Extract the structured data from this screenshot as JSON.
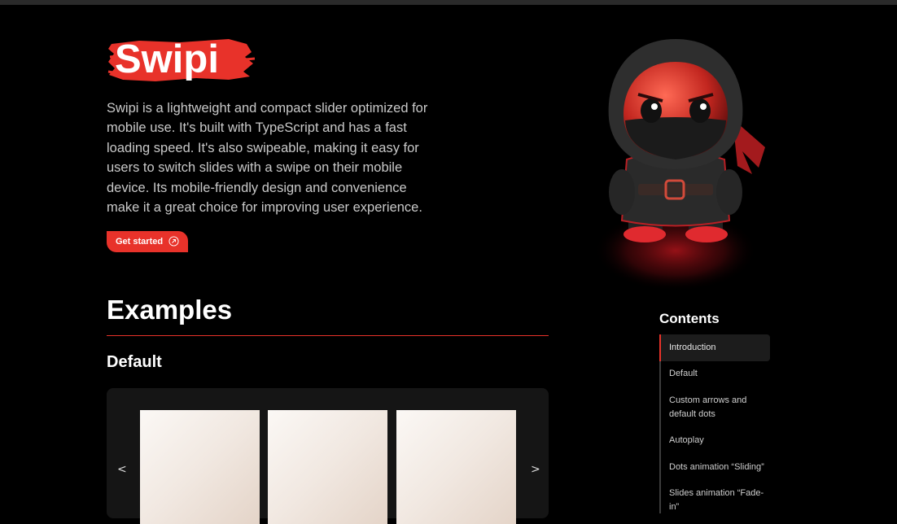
{
  "logo": {
    "text": "Swipi"
  },
  "intro": {
    "text": "Swipi is a lightweight and compact slider optimized for mobile use. It's built with TypeScript and has a fast loading speed. It's also swipeable, making it easy for users to switch slides with a swipe on their mobile device. Its mobile-friendly design and convenience make it a great choice for improving user experience."
  },
  "cta": {
    "label": "Get started",
    "icon": "arrow-up-right-icon"
  },
  "examples": {
    "heading": "Examples",
    "default_heading": "Default",
    "slider": {
      "prev_label": "<",
      "next_label": ">",
      "slide_count": 3
    }
  },
  "contents": {
    "title": "Contents",
    "items": [
      {
        "label": "Introduction",
        "active": true
      },
      {
        "label": "Default"
      },
      {
        "label": "Custom arrows and default dots"
      },
      {
        "label": "Autoplay"
      },
      {
        "label": "Dots animation “Sliding”"
      },
      {
        "label": "Slides animation “Fade-in”"
      }
    ]
  },
  "colors": {
    "accent": "#e8322a",
    "background": "#000000",
    "panel": "#151515"
  }
}
